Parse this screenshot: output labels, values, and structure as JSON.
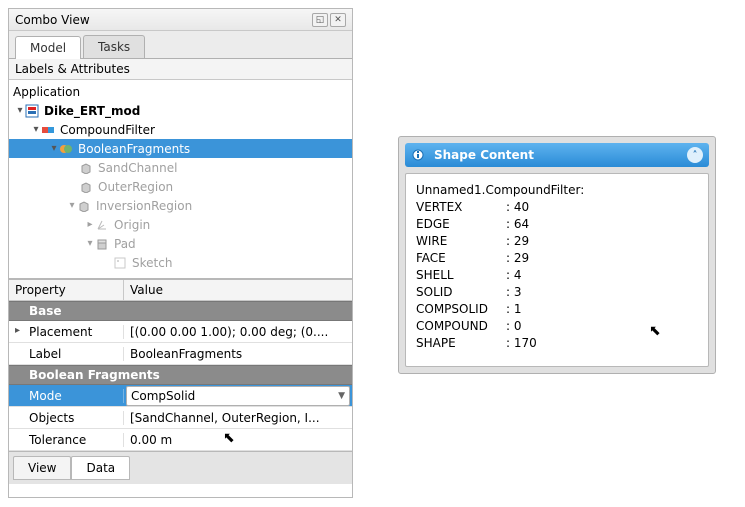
{
  "combo": {
    "title": "Combo View",
    "tabs": {
      "model": "Model",
      "tasks": "Tasks"
    },
    "labels_header": "Labels & Attributes",
    "tree": {
      "app": "Application",
      "doc": "Dike_ERT_mod",
      "compound_filter": "CompoundFilter",
      "boolean_fragments": "BooleanFragments",
      "sand_channel": "SandChannel",
      "outer_region": "OuterRegion",
      "inversion_region": "InversionRegion",
      "origin": "Origin",
      "pad": "Pad",
      "sketch": "Sketch"
    }
  },
  "properties": {
    "header_property": "Property",
    "header_value": "Value",
    "group_base": "Base",
    "rows_base": {
      "placement": {
        "k": "Placement",
        "v": "[(0.00 0.00 1.00); 0.00 deg; (0...."
      },
      "label": {
        "k": "Label",
        "v": "BooleanFragments"
      }
    },
    "group_bf": "Boolean Fragments",
    "rows_bf": {
      "mode": {
        "k": "Mode",
        "v": "CompSolid"
      },
      "objects": {
        "k": "Objects",
        "v": "[SandChannel, OuterRegion, I..."
      },
      "tolerance": {
        "k": "Tolerance",
        "v": "0.00 m"
      }
    },
    "bottom_tabs": {
      "view": "View",
      "data": "Data"
    }
  },
  "shapecontent": {
    "title": "Shape Content",
    "object": "Unnamed1.CompoundFilter:",
    "stats": [
      {
        "key": "VERTEX",
        "val": "40"
      },
      {
        "key": "EDGE",
        "val": "64"
      },
      {
        "key": "WIRE",
        "val": "29"
      },
      {
        "key": "FACE",
        "val": "29"
      },
      {
        "key": "SHELL",
        "val": "4"
      },
      {
        "key": "SOLID",
        "val": "3"
      },
      {
        "key": "COMPSOLID",
        "val": "1"
      },
      {
        "key": "COMPOUND",
        "val": "0"
      },
      {
        "key": "SHAPE",
        "val": "170"
      }
    ]
  }
}
